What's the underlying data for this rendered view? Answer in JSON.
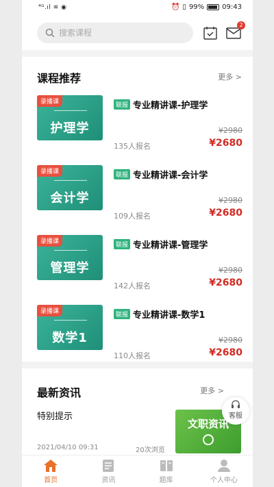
{
  "status": {
    "left": "⁴ᴳ.ıl ≋ ◉",
    "battery": "99%",
    "time": "09:43"
  },
  "search": {
    "placeholder": "搜索课程"
  },
  "header": {
    "mail_badge": "2"
  },
  "recommend": {
    "title": "课程推荐",
    "more": "更多 >",
    "courses": [
      {
        "tag": "录播课",
        "subject": "护理学",
        "label": "联报",
        "title": "专业精讲课-护理学",
        "enrolled": "135人报名",
        "old_price": "¥2980",
        "price": "¥2680"
      },
      {
        "tag": "录播课",
        "subject": "会计学",
        "label": "联报",
        "title": "专业精讲课-会计学",
        "enrolled": "109人报名",
        "old_price": "¥2980",
        "price": "¥2680"
      },
      {
        "tag": "录播课",
        "subject": "管理学",
        "label": "联报",
        "title": "专业精讲课-管理学",
        "enrolled": "142人报名",
        "old_price": "¥2980",
        "price": "¥2680"
      },
      {
        "tag": "录播课",
        "subject": "数学1",
        "label": "联报",
        "title": "专业精讲课-数学1",
        "enrolled": "110人报名",
        "old_price": "¥2980",
        "price": "¥2680"
      }
    ]
  },
  "news": {
    "title": "最新资讯",
    "more": "更多 >",
    "item_title": "特别提示",
    "date": "2021/04/10 09:31",
    "views": "20次浏览",
    "thumb_text": "文职资讯"
  },
  "service": {
    "label": "客服"
  },
  "tabs": [
    {
      "label": "首页",
      "icon": "home-icon",
      "active": true
    },
    {
      "label": "资讯",
      "icon": "news-icon",
      "active": false
    },
    {
      "label": "题库",
      "icon": "book-icon",
      "active": false
    },
    {
      "label": "个人中心",
      "icon": "user-icon",
      "active": false
    }
  ],
  "colors": {
    "accent": "#e8702a",
    "price": "#d22b24",
    "green": "#31b37e"
  }
}
